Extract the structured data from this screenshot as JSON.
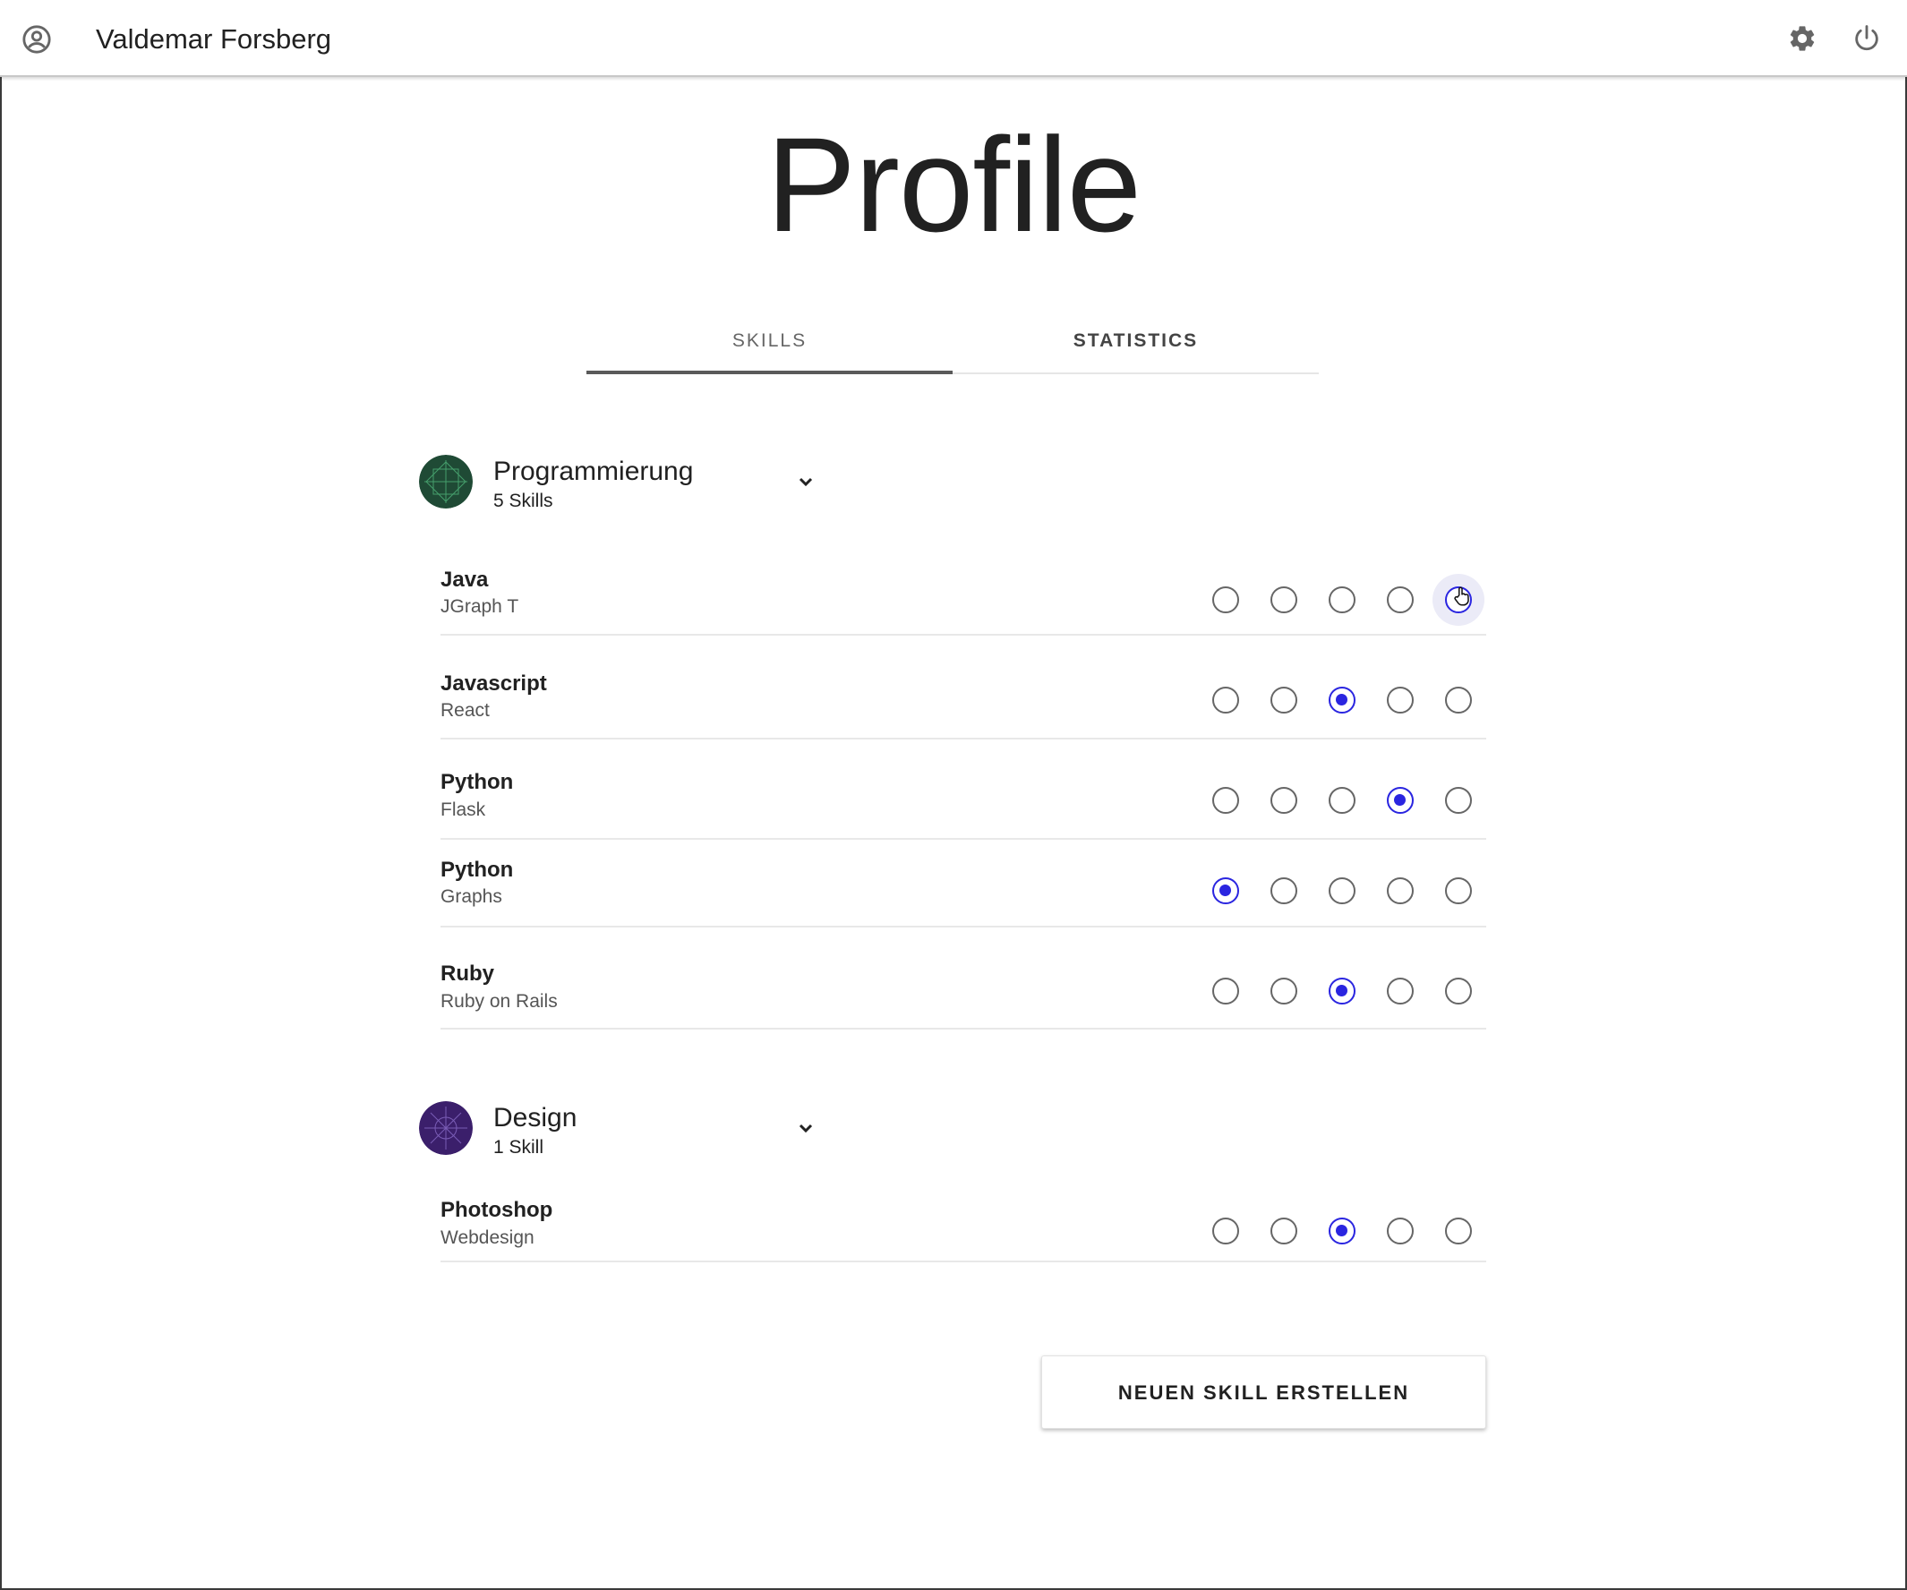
{
  "header": {
    "user_name": "Valdemar Forsberg",
    "icons": [
      "account-circle-icon",
      "gear-icon",
      "power-icon"
    ]
  },
  "page": {
    "title": "Profile"
  },
  "tabs": [
    {
      "label": "SKILLS",
      "active": true
    },
    {
      "label": "STATISTICS",
      "active": false
    }
  ],
  "categories": [
    {
      "title": "Programmierung",
      "count": "5 Skills",
      "avatar_color": "#1f4a35",
      "skills": [
        {
          "name": "Java",
          "sub": "JGraph T",
          "rating": 5,
          "hover": true
        },
        {
          "name": "Javascript",
          "sub": "React",
          "rating": 3
        },
        {
          "name": "Python",
          "sub": "Flask",
          "rating": 4
        },
        {
          "name": "Python",
          "sub": "Graphs",
          "rating": 1
        },
        {
          "name": "Ruby",
          "sub": "Ruby on Rails",
          "rating": 3
        }
      ]
    },
    {
      "title": "Design",
      "count": "1 Skill",
      "avatar_color": "#3b1f6b",
      "skills": [
        {
          "name": "Photoshop",
          "sub": "Webdesign",
          "rating": 3
        }
      ]
    }
  ],
  "actions": {
    "new_skill_label": "NEUEN SKILL ERSTELLEN"
  },
  "colors": {
    "accent": "#2a25e0",
    "text": "#212121"
  }
}
